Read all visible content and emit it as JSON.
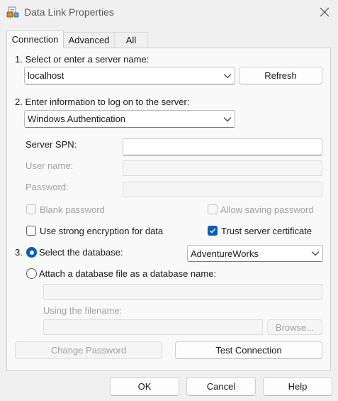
{
  "window": {
    "title": "Data Link Properties"
  },
  "tabs": [
    {
      "label": "Connection",
      "active": true
    },
    {
      "label": "Advanced",
      "active": false
    },
    {
      "label": "All",
      "active": false
    }
  ],
  "step1": {
    "label": "1. Select or enter a server name:",
    "server_value": "localhost",
    "refresh_label": "Refresh"
  },
  "step2": {
    "label": "2. Enter information to log on to the server:",
    "auth_value": "Windows Authentication",
    "spn_label": "Server SPN:",
    "spn_value": "",
    "username_label": "User name:",
    "password_label": "Password:",
    "blank_password_label": "Blank password",
    "allow_saving_label": "Allow saving password",
    "strong_encryption_label": "Use strong encryption for data",
    "trust_cert_label": "Trust server certificate"
  },
  "step3": {
    "number": "3.",
    "select_db_label": "Select the database:",
    "database_value": "AdventureWorks",
    "attach_label": "Attach a database file as a database name:",
    "filename_label": "Using the filename:",
    "browse_label": "Browse...",
    "change_password_label": "Change Password",
    "test_connection_label": "Test Connection"
  },
  "footer": {
    "ok_label": "OK",
    "cancel_label": "Cancel",
    "help_label": "Help"
  },
  "colors": {
    "accent": "#0a5cb8",
    "window_bg": "#f0f0f0",
    "panel_bg": "#f9f9f9"
  },
  "icons": [
    "data-link-app-icon",
    "close-icon",
    "chevron-down-icon",
    "checkmark-icon"
  ]
}
